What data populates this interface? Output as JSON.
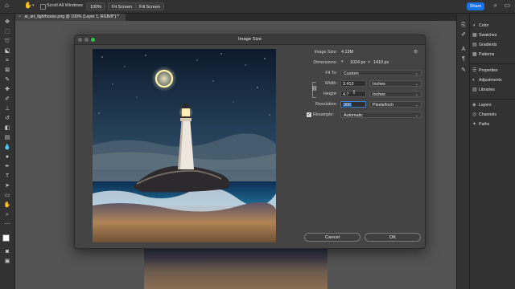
{
  "option_bar": {
    "scroll_all_windows": "Scroll All Windows",
    "zoom": "100%",
    "fit_screen": "Fit Screen",
    "fill_screen": "Fill Screen",
    "share": "Share"
  },
  "document_tab": {
    "title": "ai_art_lighthouse.png @ 100% (Layer 1, RGB/8*) *"
  },
  "right_panels": {
    "group1": [
      "Color",
      "Swatches",
      "Gradients",
      "Patterns"
    ],
    "group2": [
      "Properties",
      "Adjustments",
      "Libraries"
    ],
    "group3": [
      "Layers",
      "Channels",
      "Paths"
    ]
  },
  "dialog": {
    "title": "Image Size",
    "image_size_label": "Image Size:",
    "image_size_value": "4.13M",
    "dimensions_label": "Dimensions:",
    "dimensions_w": "1024 px",
    "dimensions_x": "×",
    "dimensions_h": "1410 px",
    "fit_to_label": "Fit To:",
    "fit_to_value": "Custom",
    "width_label": "Width:",
    "width_value": "3.413",
    "width_unit": "Inches",
    "height_label": "Height:",
    "height_value": "4.7",
    "height_unit": "Inches",
    "resolution_label": "Resolution:",
    "resolution_value": "300",
    "resolution_unit": "Pixels/Inch",
    "resample_label": "Resample:",
    "resample_checked": true,
    "resample_value": "Automatic",
    "cancel_label": "Cancel",
    "ok_label": "OK"
  }
}
